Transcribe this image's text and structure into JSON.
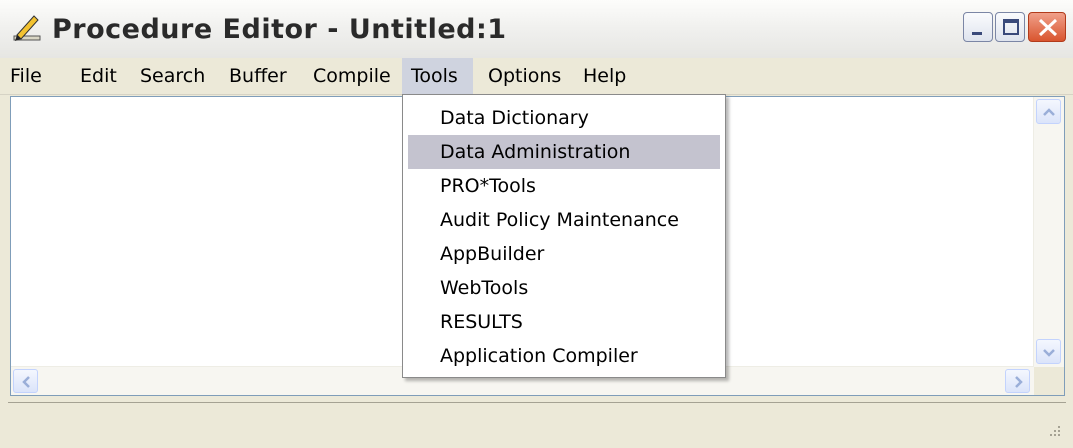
{
  "window": {
    "title": "Procedure Editor - Untitled:1",
    "app_icon": "pen-ruler-icon",
    "controls": [
      "minimize-icon",
      "maximize-icon",
      "close-icon"
    ]
  },
  "menubar": {
    "items": [
      {
        "label": "File"
      },
      {
        "label": "Edit"
      },
      {
        "label": "Search"
      },
      {
        "label": "Buffer"
      },
      {
        "label": "Compile"
      },
      {
        "label": "Tools",
        "active": true
      },
      {
        "label": "Options"
      },
      {
        "label": "Help"
      }
    ]
  },
  "tools_menu": {
    "items": [
      {
        "label": "Data Dictionary"
      },
      {
        "label": "Data Administration",
        "highlighted": true
      },
      {
        "label": "PRO*Tools"
      },
      {
        "label": "Audit Policy Maintenance"
      },
      {
        "label": "AppBuilder"
      },
      {
        "label": "WebTools"
      },
      {
        "label": "RESULTS"
      },
      {
        "label": "Application Compiler"
      }
    ]
  },
  "editor": {
    "content": ""
  },
  "colors": {
    "title_bar": "#f1f1ef",
    "menu_highlight": "#c4c3cf",
    "window_face": "#ece9d8",
    "close_button": "#d9552f"
  }
}
